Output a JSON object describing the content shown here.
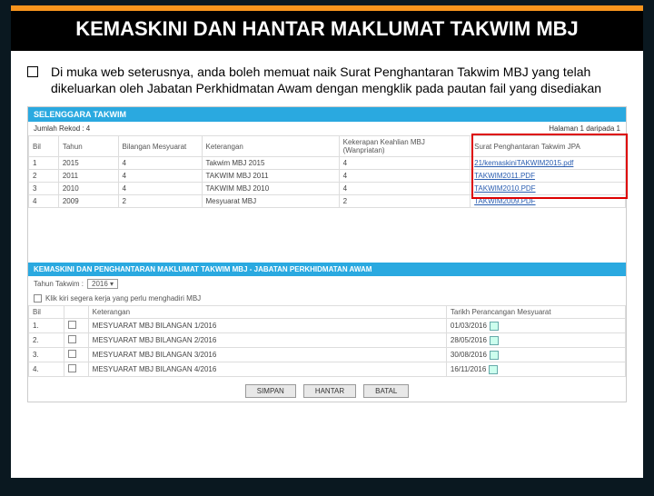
{
  "title": "KEMASKINI DAN HANTAR MAKLUMAT TAKWIM MBJ",
  "bullet": "Di muka web seterusnya, anda boleh memuat naik Surat Penghantaran Takwim MBJ yang telah dikeluarkan oleh Jabatan Perkhidmatan Awam dengan mengklik pada pautan fail yang disediakan",
  "panel1": {
    "header": "SELENGGARA TAKWIM",
    "record_label": "Jumlah Rekod : 4",
    "page_label": "Halaman 1 daripada 1",
    "cols": [
      "Bil",
      "Tahun",
      "Bilangan Mesyuarat",
      "Keterangan",
      "Kekerapan Keahlian MBJ (Wanpriatan)",
      "Surat Penghantaran Takwim JPA"
    ],
    "rows": [
      {
        "bil": "1",
        "tahun": "2015",
        "bilangan": "4",
        "ket": "Takwim MBJ 2015",
        "kek": "4",
        "surat": "21/kemaskiniTAKWIM2015.pdf"
      },
      {
        "bil": "2",
        "tahun": "2011",
        "bilangan": "4",
        "ket": "TAKWIM MBJ 2011",
        "kek": "4",
        "surat": "TAKWIM2011.PDF"
      },
      {
        "bil": "3",
        "tahun": "2010",
        "bilangan": "4",
        "ket": "TAKWIM MBJ 2010",
        "kek": "4",
        "surat": "TAKWIM2010.PDF"
      },
      {
        "bil": "4",
        "tahun": "2009",
        "bilangan": "2",
        "ket": "Mesyuarat MBJ",
        "kek": "2",
        "surat": "TAKWIM2009.PDF"
      }
    ]
  },
  "panel2": {
    "header": "KEMASKINI DAN PENGHANTARAN MAKLUMAT TAKWIM MBJ - JABATAN PERKHIDMATAN AWAM",
    "year_label": "Tahun Takwim :",
    "year_value": "2016",
    "checkbox_label": "Klik kiri segera kerja yang perlu menghadiri MBJ",
    "cols": [
      "Bil",
      "",
      "Keterangan",
      "Tarikh Perancangan Mesyuarat"
    ],
    "rows": [
      {
        "bil": "1.",
        "ket": "MESYUARAT MBJ BILANGAN 1/2016",
        "tarikh": "01/03/2016"
      },
      {
        "bil": "2.",
        "ket": "MESYUARAT MBJ BILANGAN 2/2016",
        "tarikh": "28/05/2016"
      },
      {
        "bil": "3.",
        "ket": "MESYUARAT MBJ BILANGAN 3/2016",
        "tarikh": "30/08/2016"
      },
      {
        "bil": "4.",
        "ket": "MESYUARAT MBJ BILANGAN 4/2016",
        "tarikh": "16/11/2016"
      }
    ],
    "buttons": {
      "save": "SIMPAN",
      "send": "HANTAR",
      "cancel": "BATAL"
    }
  }
}
